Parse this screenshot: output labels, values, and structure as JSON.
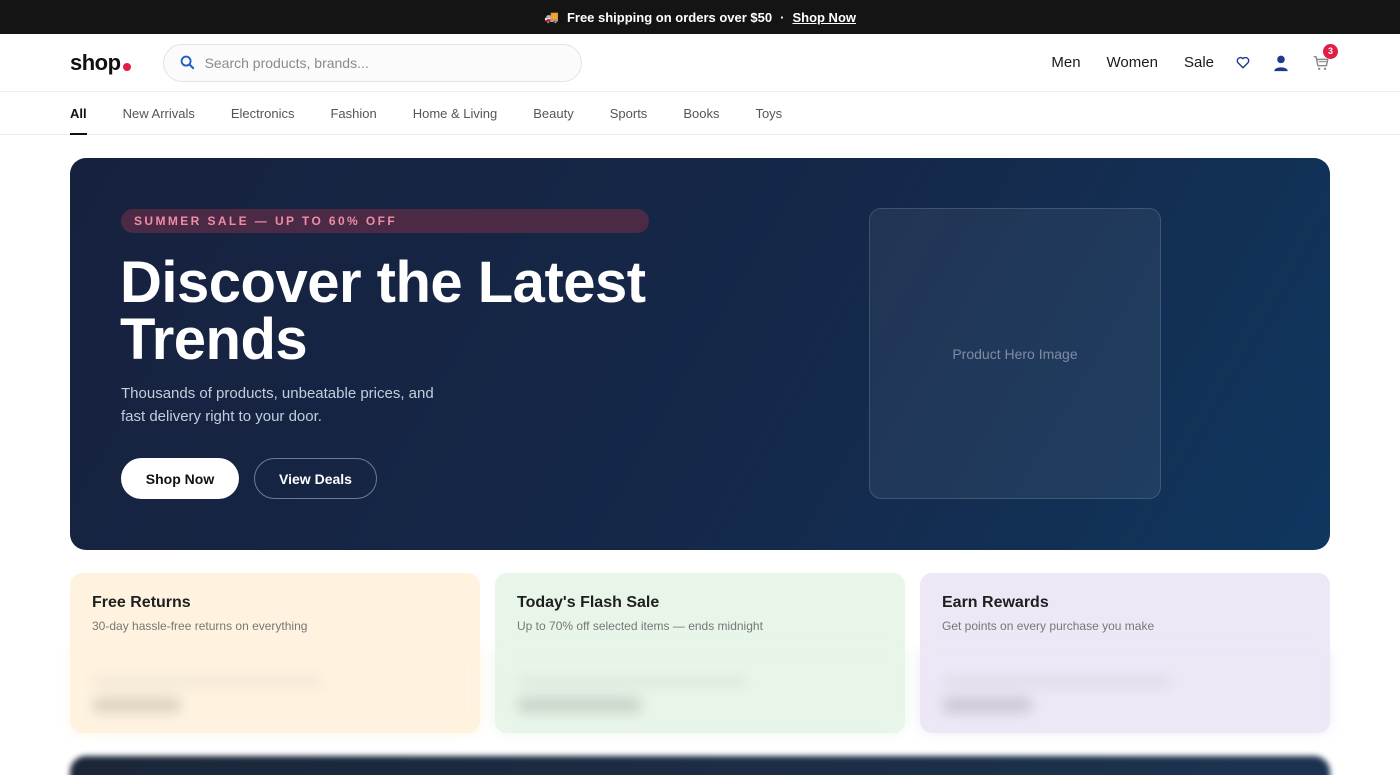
{
  "announcement": {
    "truck_icon": "🚚",
    "text": "Free shipping on orders over $50",
    "separator": "·",
    "link": "Shop Now"
  },
  "header": {
    "logo_text": "shop",
    "search_placeholder": "Search products, brands...",
    "nav": [
      "Men",
      "Women",
      "Sale"
    ],
    "icons": [
      "heart-icon",
      "user-icon",
      "cart-icon"
    ],
    "cart_count": "3",
    "colors": {
      "brand_dot": "#e11d48"
    }
  },
  "categories": {
    "items": [
      "All",
      "New Arrivals",
      "Electronics",
      "Fashion",
      "Home & Living",
      "Beauty",
      "Sports",
      "Books",
      "Toys"
    ],
    "active": "All"
  },
  "hero": {
    "pill": "SUMMER SALE — UP TO 60% OFF",
    "title": "Discover the Latest Trends",
    "subtitle": "Thousands of products, unbeatable prices, and fast delivery right to your door.",
    "primary_button": "Shop Now",
    "secondary_button": "View Deals",
    "image_placeholder": "Product Hero Image",
    "colors": {
      "background": "#16213e",
      "pill_text": "#f08ca6"
    }
  },
  "promos": [
    {
      "title": "Free Returns",
      "description": "30-day hassle-free returns on everything",
      "bg": "#fff3e0"
    },
    {
      "title": "Today's Flash Sale",
      "description": "Up to 70% off selected items — ends midnight",
      "bg": "#e8f5e9"
    },
    {
      "title": "Earn Rewards",
      "description": "Get points on every purchase you make",
      "bg": "#ede7f6"
    }
  ]
}
